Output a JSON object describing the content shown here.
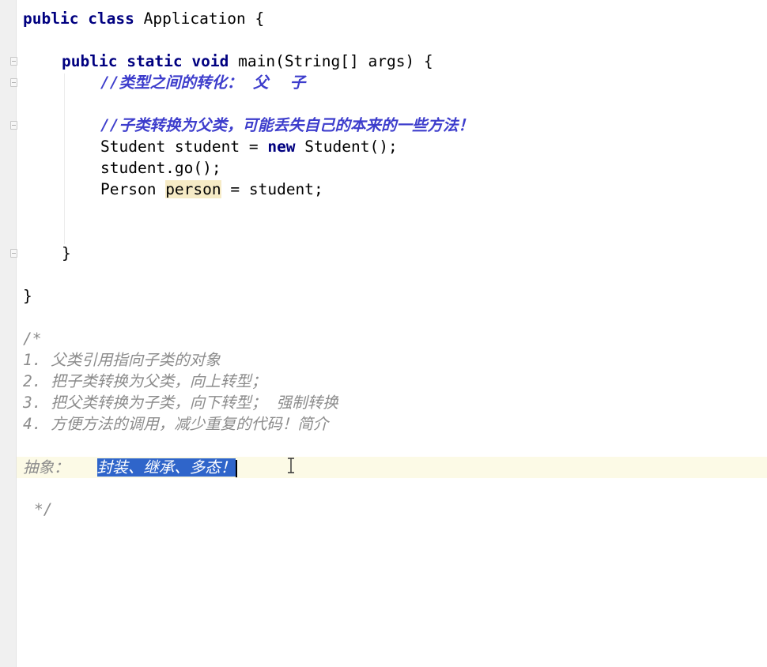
{
  "code": {
    "l1": {
      "kw1": "public",
      "kw2": "class",
      "rest": " Application {"
    },
    "l2": {
      "kw1": "public",
      "kw2": "static",
      "kw3": "void",
      "rest": " main(String[] args) {"
    },
    "l3": {
      "slashes": "//",
      "text": "类型之间的转化：  父    子"
    },
    "l4": {
      "slashes": "//",
      "text": "子类转换为父类，可能丢失自己的本来的一些方法！"
    },
    "l5": {
      "pre": "Student student = ",
      "kw": "new",
      "post": " Student();"
    },
    "l6": {
      "text": "student.go();"
    },
    "l7": {
      "pre": "Person ",
      "var": "person",
      "post": " = student;"
    },
    "l8": {
      "text": "}"
    },
    "l9": {
      "text": "}"
    }
  },
  "block_comment": {
    "open": "/*",
    "items": [
      {
        "num": "1.",
        "text": "父类引用指向子类的对象"
      },
      {
        "num": "2.",
        "text": "把子类转换为父类，向上转型；"
      },
      {
        "num": "3.",
        "text": "把父类转换为子类，向下转型；  强制转换"
      },
      {
        "num": "4.",
        "text": "方便方法的调用，减少重复的代码！简介"
      }
    ],
    "abstract_label": "抽象：",
    "abstract_selected": "封装、继承、多态！",
    "close": "*/"
  }
}
